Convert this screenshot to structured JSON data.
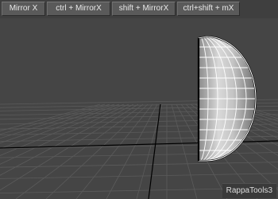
{
  "toolbar": {
    "buttons": [
      {
        "label": "Mirror X"
      },
      {
        "label": "ctrl + MirrorX"
      },
      {
        "label": "shift + MirrorX"
      },
      {
        "label": "ctrl+shift + mX"
      }
    ]
  },
  "viewport": {
    "background": "#454545",
    "grid_color": "#5b5b5b",
    "axis_color": "#000000",
    "mesh_color": "#ffffff",
    "object": "half-sphere-mesh"
  },
  "watermark": {
    "label": "RappaTools3"
  }
}
